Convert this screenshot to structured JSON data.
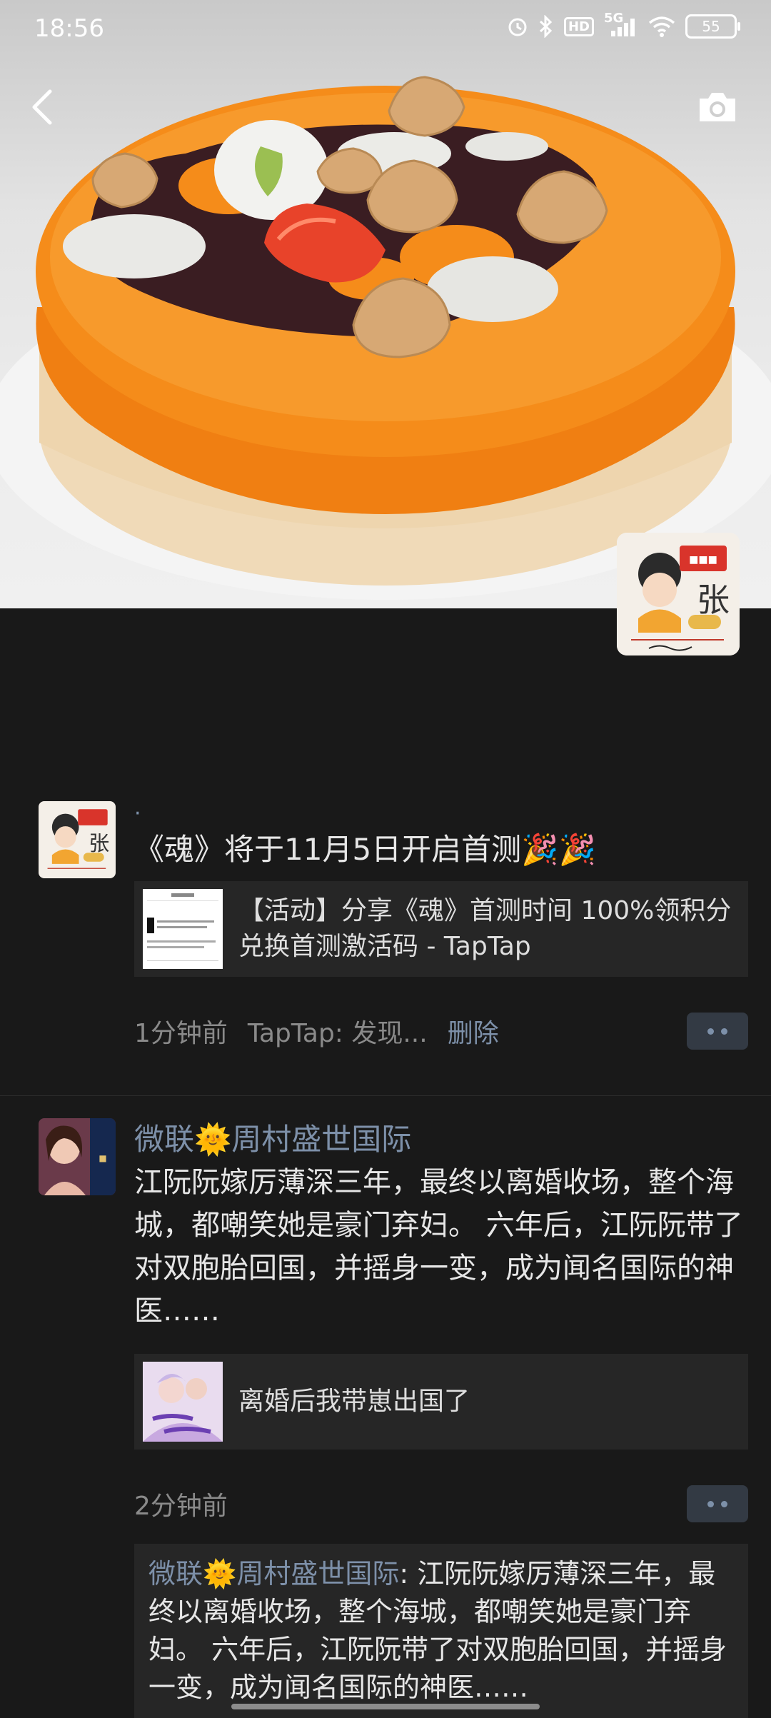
{
  "status_bar": {
    "time": "18:56",
    "network": "5G",
    "hd": "HD",
    "battery": "55",
    "icons": [
      "alarm-icon",
      "bluetooth-icon",
      "hd-icon",
      "signal-icon",
      "wifi-icon",
      "battery-icon"
    ]
  },
  "header": {
    "back_icon": "chevron-left-icon",
    "camera_icon": "camera-icon"
  },
  "posts": [
    {
      "author": "·",
      "text": "《魂》将于11月5日开启首测🎉🎉",
      "link": {
        "title": "【活动】分享《魂》首测时间 100%领积分兑换首测激活码 - TapTap"
      },
      "time": "1分钟前",
      "source": "TapTap: 发现...",
      "delete": "删除"
    },
    {
      "author": "微联🌞周村盛世国际",
      "text": "江阮阮嫁厉薄深三年，最终以离婚收场，整个海城，都嘲笑她是豪门弃妇。 六年后，江阮阮带了对双胞胎回国，并摇身一变，成为闻名国际的神医……",
      "link": {
        "title": "离婚后我带崽出国了"
      },
      "time": "2分钟前",
      "comment": {
        "author": "微联🌞周村盛世国际",
        "separator": ": ",
        "text": "江阮阮嫁厉薄深三年，最终以离婚收场，整个海城，都嘲笑她是豪门弃妇。 六年后，江阮阮带了对双胞胎回国，并摇身一变，成为闻名国际的神医……"
      }
    }
  ],
  "colors": {
    "background": "#191919",
    "link_blue": "#7d90a9",
    "card": "#262626",
    "cake_orange": "#f08a1c"
  }
}
